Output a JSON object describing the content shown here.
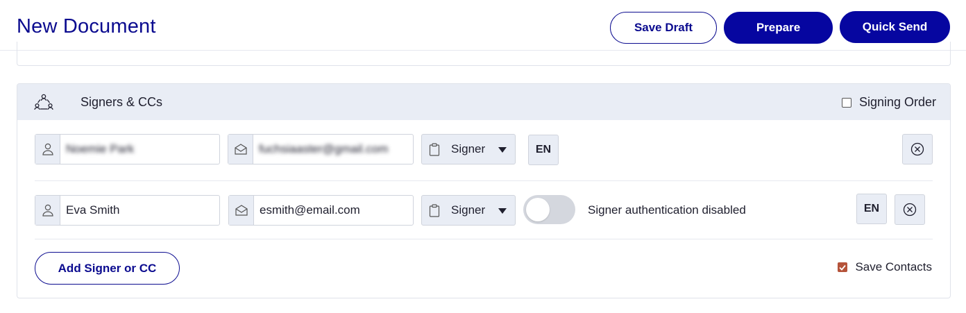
{
  "header": {
    "title": "New Document",
    "save_draft_label": "Save Draft",
    "prepare_label": "Prepare",
    "quick_send_label": "Quick Send"
  },
  "signers_panel": {
    "title": "Signers & CCs",
    "signing_order_label": "Signing Order",
    "signing_order_checked": false,
    "signers": [
      {
        "name": "Noemie Park",
        "email": "fuchsiaaster@gmail.com",
        "role": "Signer",
        "language": "EN",
        "blurred": true
      },
      {
        "name": "Eva Smith",
        "email": "esmith@email.com",
        "role": "Signer",
        "language": "EN",
        "auth_label": "Signer authentication disabled",
        "auth_enabled": false
      }
    ],
    "add_button_label": "Add Signer or CC",
    "save_contacts_label": "Save Contacts",
    "save_contacts_checked": true
  },
  "colors": {
    "brand": "#0606a0",
    "header_bg": "#e9edf5",
    "checkbox_accent": "#b5533a"
  },
  "icons": {
    "signers": "people-group-icon",
    "name": "person-icon",
    "email": "envelope-open-icon",
    "role": "clipboard-icon",
    "remove": "circle-x-icon",
    "dropdown": "caret-down-icon"
  }
}
